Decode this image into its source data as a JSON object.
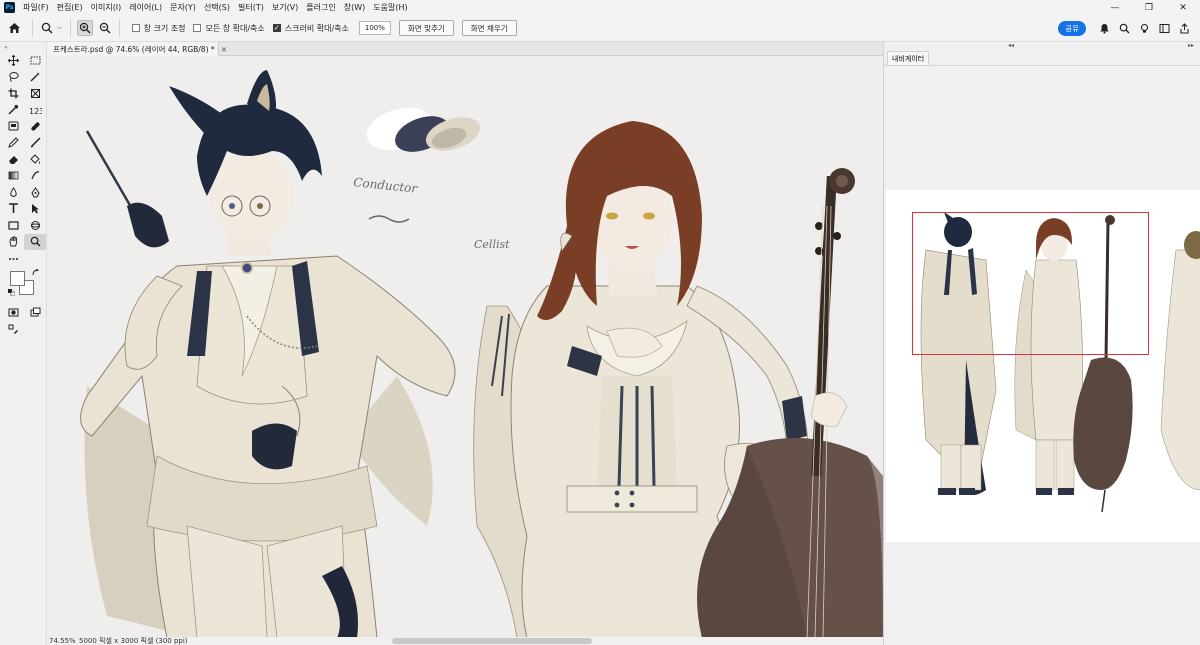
{
  "app": {
    "logo": "Ps"
  },
  "menu": [
    "파일(F)",
    "편집(E)",
    "이미지(I)",
    "레이어(L)",
    "문자(Y)",
    "선택(S)",
    "필터(T)",
    "보기(V)",
    "플러그인",
    "창(W)",
    "도움말(H)"
  ],
  "window_controls": {
    "minimize": "—",
    "maximize": "❐",
    "close": "✕"
  },
  "options": {
    "resize_windows": "창 크기 조정",
    "zoom_all_windows": "모든 창 확대/축소",
    "scrubby_zoom": "스크러비 확대/축소",
    "zoom_field": "100%",
    "fit_screen": "화면 맞추기",
    "fill_screen": "화면 채우기",
    "resize_windows_checked": false,
    "zoom_all_checked": false,
    "scrubby_checked": true,
    "share": "공유",
    "accent_color": "#1473e6"
  },
  "document": {
    "tab_title": "프케스트라.psd @ 74.6% (레이어 44, RGB/8) *",
    "close": "×"
  },
  "canvas_annotations": {
    "conductor": "Conductor",
    "cellist": "Cellist"
  },
  "status": {
    "zoom": "74.55%",
    "info": "5000 픽셀 x 3000 픽셀 (300 ppi)"
  },
  "right_panel": {
    "collapse_left": "◂◂",
    "collapse_right": "▸▸",
    "tab": "내비게이터",
    "proxy_color": "#e0323c"
  },
  "tools": [
    "move-tool-icon",
    "marquee-tool-icon",
    "lasso-tool-icon",
    "magic-wand-tool-icon",
    "crop-tool-icon",
    "frame-tool-icon",
    "eyedropper-tool-icon",
    "count-tool-icon",
    "spot-healing-tool-icon",
    "bandage-tool-icon",
    "brush-tool-icon",
    "pencil-tool-icon",
    "eraser-tool-icon",
    "bucket-tool-icon",
    "gradient-tool-icon",
    "blur-tool-icon",
    "dodge-tool-icon",
    "pen-tool-icon",
    "type-tool-icon",
    "path-select-tool-icon",
    "rectangle-tool-icon",
    "hand-tool-icon",
    "zoom-tool-icon",
    "more-tools-icon"
  ]
}
